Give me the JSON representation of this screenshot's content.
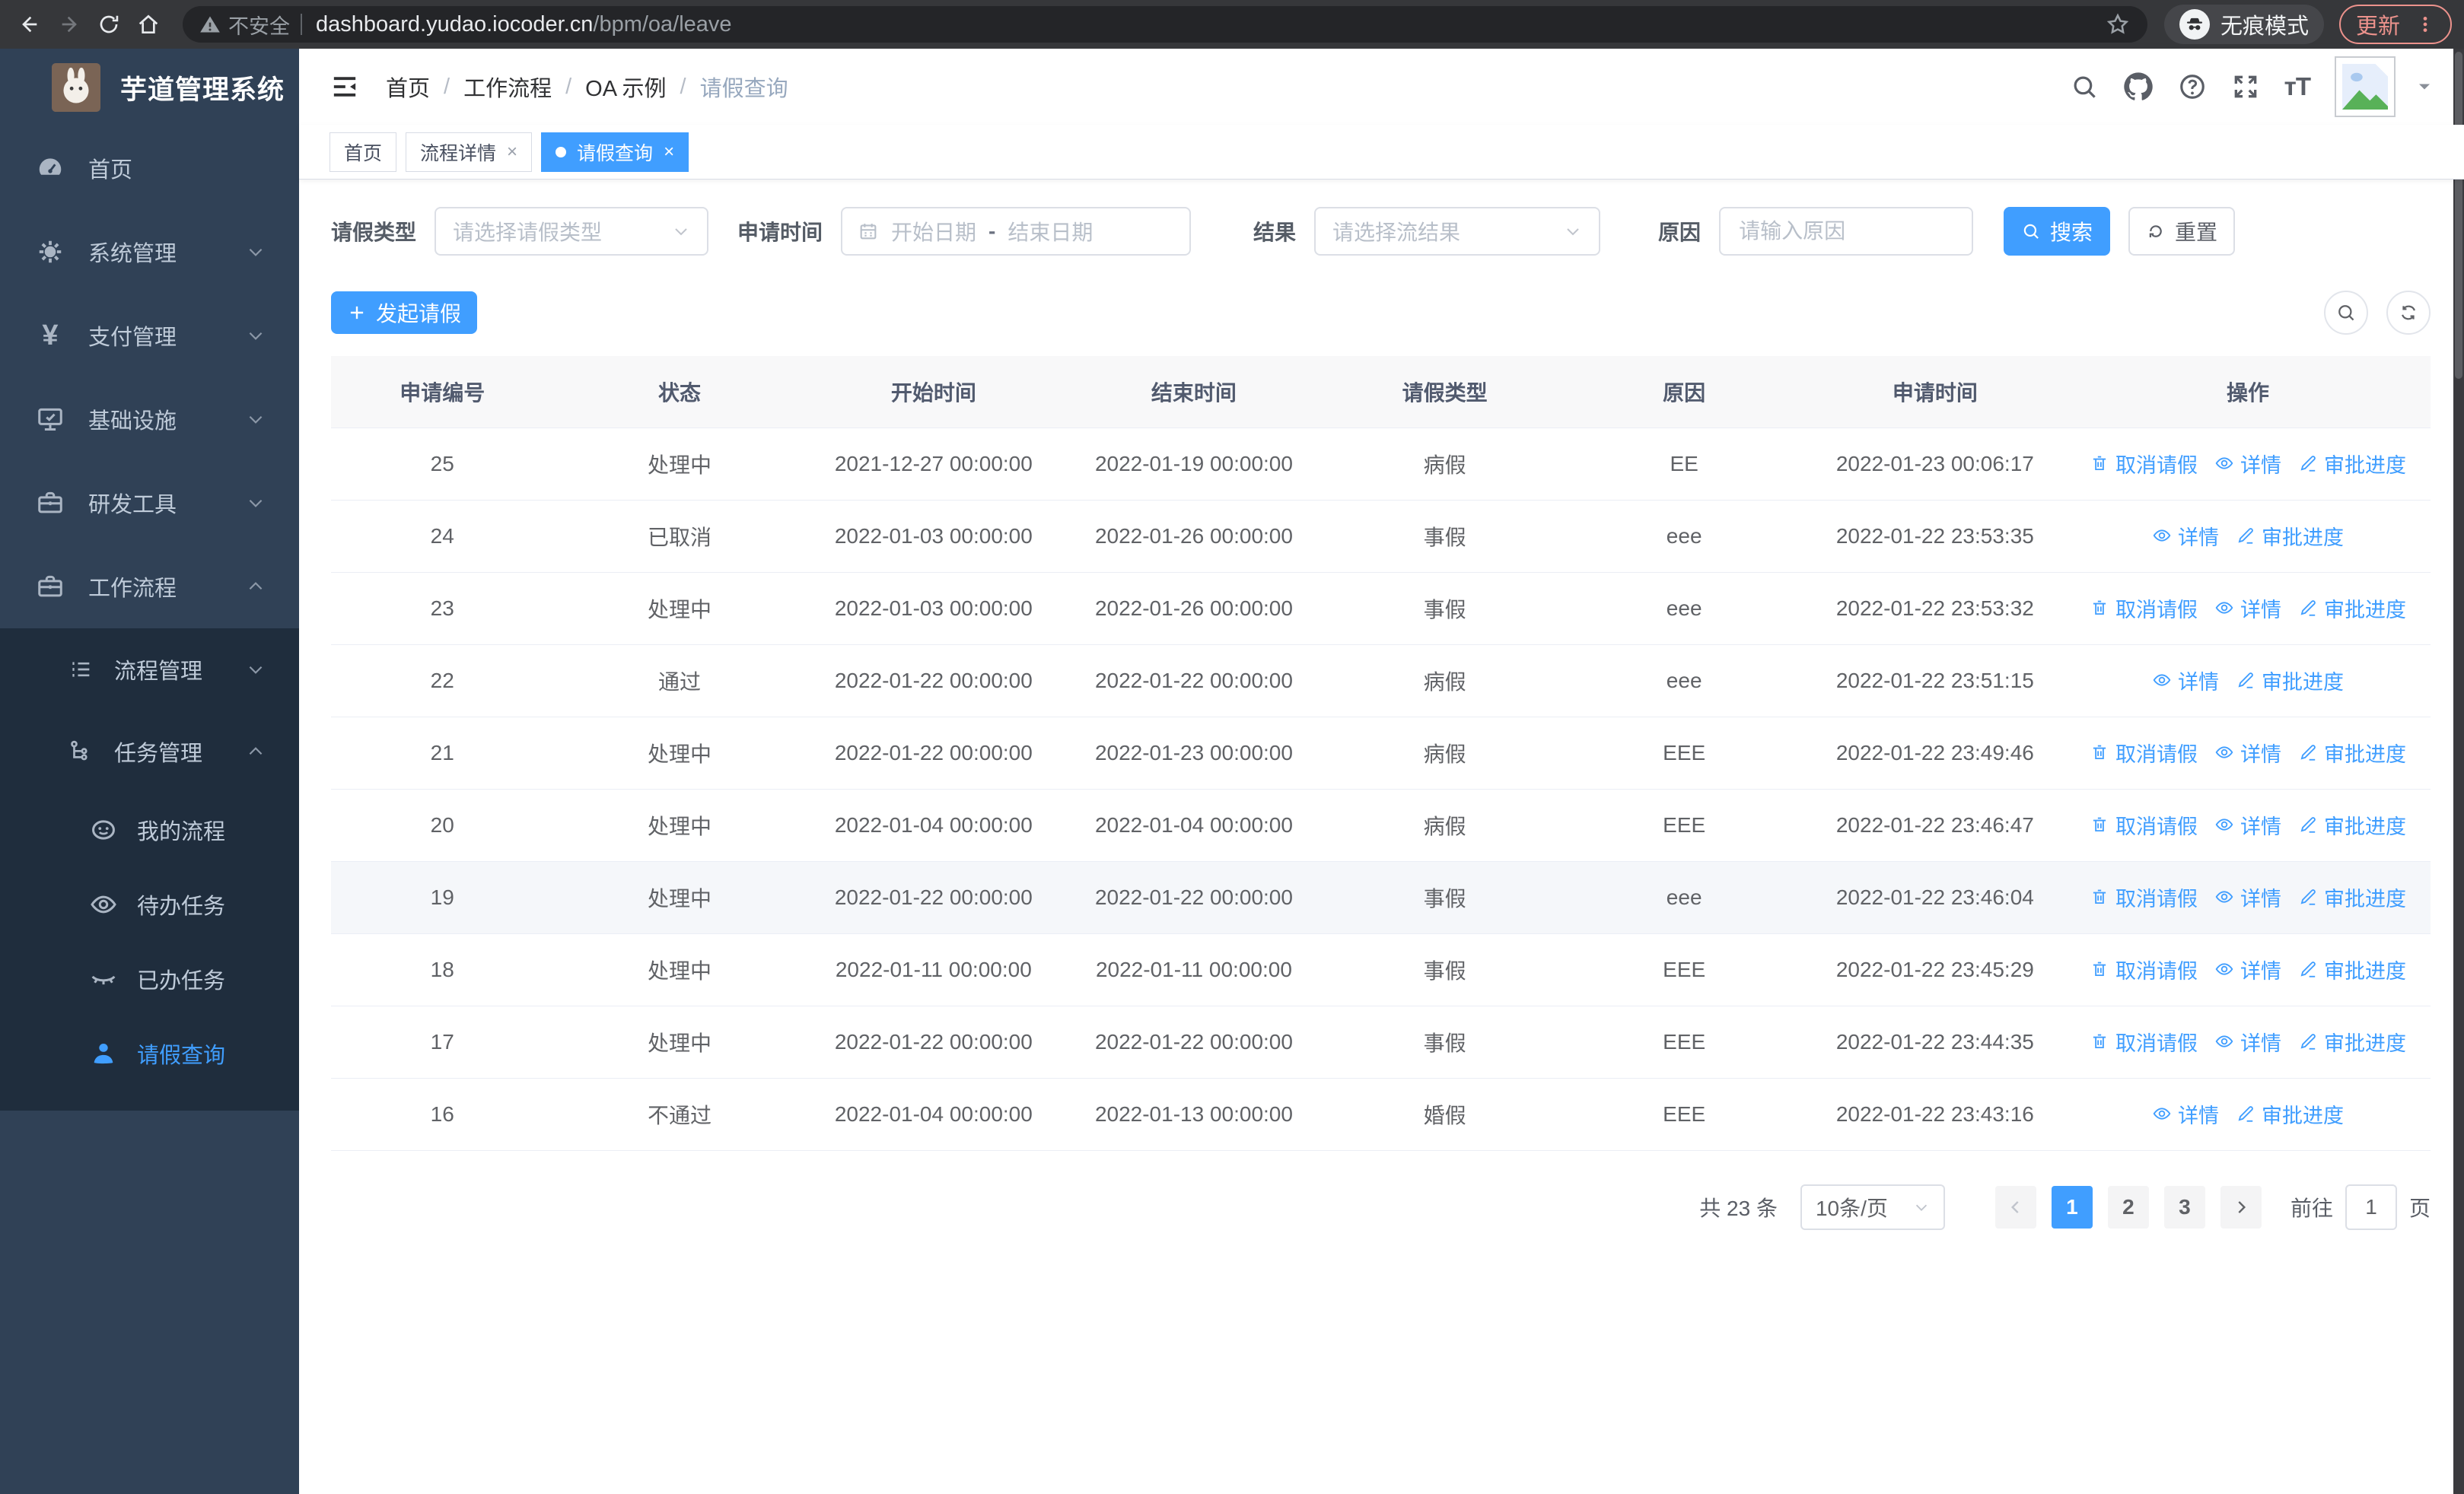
{
  "browser": {
    "security_label": "不安全",
    "url_host": "dashboard.yudao.iocoder.cn",
    "url_path": "/bpm/oa/leave",
    "incognito_label": "无痕模式",
    "update_label": "更新"
  },
  "sidebar": {
    "title": "芋道管理系统",
    "items": {
      "home": "首页",
      "system": "系统管理",
      "payment": "支付管理",
      "infra": "基础设施",
      "devtools": "研发工具",
      "workflow": "工作流程",
      "process_mgmt": "流程管理",
      "task_mgmt": "任务管理",
      "my_process": "我的流程",
      "todo_task": "待办任务",
      "done_task": "已办任务",
      "leave_query": "请假查询"
    }
  },
  "header": {
    "separator": "/",
    "breadcrumb": {
      "b0": "首页",
      "b1": "工作流程",
      "b2": "OA 示例",
      "b3": "请假查询"
    }
  },
  "tabs": {
    "t0": "首页",
    "t1": "流程详情",
    "t2": "请假查询"
  },
  "filters": {
    "leave_type_label": "请假类型",
    "leave_type_placeholder": "请选择请假类型",
    "apply_time_label": "申请时间",
    "start_placeholder": "开始日期",
    "range_separator": "-",
    "end_placeholder": "结束日期",
    "result_label": "结果",
    "result_placeholder": "请选择流结果",
    "reason_label": "原因",
    "reason_placeholder": "请输入原因",
    "search_label": "搜索",
    "reset_label": "重置"
  },
  "toolbar": {
    "create_label": "发起请假"
  },
  "table": {
    "columns": {
      "c0": "申请编号",
      "c1": "状态",
      "c2": "开始时间",
      "c3": "结束时间",
      "c4": "请假类型",
      "c5": "原因",
      "c6": "申请时间",
      "c7": "操作"
    },
    "action_labels": {
      "cancel": "取消请假",
      "detail": "详情",
      "progress": "审批进度"
    },
    "rows": [
      {
        "id": "25",
        "status": "处理中",
        "start": "2021-12-27 00:00:00",
        "end": "2022-01-19 00:00:00",
        "type": "病假",
        "reason": "EE",
        "applied": "2022-01-23 00:06:17",
        "actions": [
          "cancel",
          "detail",
          "progress"
        ],
        "highlighted": false
      },
      {
        "id": "24",
        "status": "已取消",
        "start": "2022-01-03 00:00:00",
        "end": "2022-01-26 00:00:00",
        "type": "事假",
        "reason": "eee",
        "applied": "2022-01-22 23:53:35",
        "actions": [
          "detail",
          "progress"
        ],
        "highlighted": false
      },
      {
        "id": "23",
        "status": "处理中",
        "start": "2022-01-03 00:00:00",
        "end": "2022-01-26 00:00:00",
        "type": "事假",
        "reason": "eee",
        "applied": "2022-01-22 23:53:32",
        "actions": [
          "cancel",
          "detail",
          "progress"
        ],
        "highlighted": false
      },
      {
        "id": "22",
        "status": "通过",
        "start": "2022-01-22 00:00:00",
        "end": "2022-01-22 00:00:00",
        "type": "病假",
        "reason": "eee",
        "applied": "2022-01-22 23:51:15",
        "actions": [
          "detail",
          "progress"
        ],
        "highlighted": false
      },
      {
        "id": "21",
        "status": "处理中",
        "start": "2022-01-22 00:00:00",
        "end": "2022-01-23 00:00:00",
        "type": "病假",
        "reason": "EEE",
        "applied": "2022-01-22 23:49:46",
        "actions": [
          "cancel",
          "detail",
          "progress"
        ],
        "highlighted": false
      },
      {
        "id": "20",
        "status": "处理中",
        "start": "2022-01-04 00:00:00",
        "end": "2022-01-04 00:00:00",
        "type": "病假",
        "reason": "EEE",
        "applied": "2022-01-22 23:46:47",
        "actions": [
          "cancel",
          "detail",
          "progress"
        ],
        "highlighted": false
      },
      {
        "id": "19",
        "status": "处理中",
        "start": "2022-01-22 00:00:00",
        "end": "2022-01-22 00:00:00",
        "type": "事假",
        "reason": "eee",
        "applied": "2022-01-22 23:46:04",
        "actions": [
          "cancel",
          "detail",
          "progress"
        ],
        "highlighted": true
      },
      {
        "id": "18",
        "status": "处理中",
        "start": "2022-01-11 00:00:00",
        "end": "2022-01-11 00:00:00",
        "type": "事假",
        "reason": "EEE",
        "applied": "2022-01-22 23:45:29",
        "actions": [
          "cancel",
          "detail",
          "progress"
        ],
        "highlighted": false
      },
      {
        "id": "17",
        "status": "处理中",
        "start": "2022-01-22 00:00:00",
        "end": "2022-01-22 00:00:00",
        "type": "事假",
        "reason": "EEE",
        "applied": "2022-01-22 23:44:35",
        "actions": [
          "cancel",
          "detail",
          "progress"
        ],
        "highlighted": false
      },
      {
        "id": "16",
        "status": "不通过",
        "start": "2022-01-04 00:00:00",
        "end": "2022-01-13 00:00:00",
        "type": "婚假",
        "reason": "EEE",
        "applied": "2022-01-22 23:43:16",
        "actions": [
          "detail",
          "progress"
        ],
        "highlighted": false
      }
    ]
  },
  "pagination": {
    "total": "共 23 条",
    "page_size": "10条/页",
    "page1": "1",
    "page2": "2",
    "page3": "3",
    "goto_label": "前往",
    "goto_value": "1",
    "goto_suffix": "页"
  },
  "colors": {
    "accent": "#409EFF",
    "sidebar_bg": "#304156",
    "submenu_bg": "#1F2D3D",
    "header_bg": "#F8F8F9"
  }
}
